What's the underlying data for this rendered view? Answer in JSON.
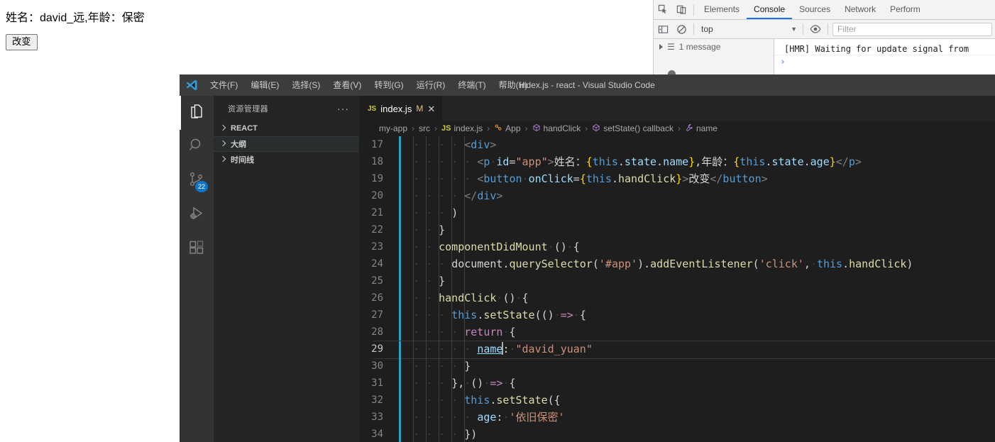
{
  "page": {
    "result_text": "姓名：david_远,年龄：保密",
    "button_label": "改变"
  },
  "devtools": {
    "icons": {
      "inspect": "inspect-element-icon",
      "device": "device-toolbar-icon",
      "sidebar_toggle": "console-sidebar-toggle-icon",
      "clear": "clear-console-icon",
      "eye": "live-expression-icon"
    },
    "tabs": [
      {
        "label": "Elements",
        "active": false
      },
      {
        "label": "Console",
        "active": true
      },
      {
        "label": "Sources",
        "active": false
      },
      {
        "label": "Network",
        "active": false
      },
      {
        "label": "Perform",
        "active": false
      }
    ],
    "context_selector": {
      "value": "top"
    },
    "filter": {
      "placeholder": "Filter",
      "value": ""
    },
    "sidebar": {
      "message_count_label": "1 message"
    },
    "log": [
      {
        "text": "[HMR] Waiting for update signal from"
      }
    ],
    "prompt_symbol": "›",
    "accent_color": "#1a73e8"
  },
  "vscode": {
    "window_title": "index.js - react - Visual Studio Code",
    "menu": [
      "文件(F)",
      "编辑(E)",
      "选择(S)",
      "查看(V)",
      "转到(G)",
      "运行(R)",
      "终端(T)",
      "帮助(H)"
    ],
    "activity_bar": [
      {
        "name": "explorer",
        "icon": "files-icon",
        "active": true,
        "badge": ""
      },
      {
        "name": "search",
        "icon": "search-icon",
        "active": false,
        "badge": ""
      },
      {
        "name": "source-control",
        "icon": "source-control-icon",
        "active": false,
        "badge": "22"
      },
      {
        "name": "run-and-debug",
        "icon": "run-debug-icon",
        "active": false,
        "badge": ""
      },
      {
        "name": "extensions",
        "icon": "extensions-icon",
        "active": false,
        "badge": ""
      }
    ],
    "sidebar": {
      "title": "资源管理器",
      "more_actions": "···",
      "sections": [
        {
          "label": "REACT",
          "expanded": false,
          "highlight": false
        },
        {
          "label": "大纲",
          "expanded": false,
          "highlight": true
        },
        {
          "label": "时间线",
          "expanded": false,
          "highlight": false
        }
      ]
    },
    "tabs": [
      {
        "badge": "JS",
        "label": "index.js",
        "modified": "M",
        "close": "✕",
        "active": true
      }
    ],
    "breadcrumb": [
      {
        "icon": "",
        "label": "my-app"
      },
      {
        "icon": "",
        "label": "src"
      },
      {
        "icon": "JS",
        "label": "index.js"
      },
      {
        "icon": "class",
        "label": "App"
      },
      {
        "icon": "method",
        "label": "handClick"
      },
      {
        "icon": "method",
        "label": "setState() callback"
      },
      {
        "icon": "property",
        "label": "name"
      }
    ],
    "code": {
      "first_line_number": 17,
      "active_line_number": 29,
      "lines": [
        {
          "n": 17,
          "indent": 4,
          "tokens": [
            {
              "t": "<",
              "c": "t-punc"
            },
            {
              "t": "div",
              "c": "t-tag"
            },
            {
              "t": ">",
              "c": "t-punc"
            }
          ]
        },
        {
          "n": 18,
          "indent": 5,
          "tokens": [
            {
              "t": "<",
              "c": "t-punc"
            },
            {
              "t": "p",
              "c": "t-tag"
            },
            {
              "t": " ",
              "c": "ws"
            },
            {
              "t": "id",
              "c": "t-attr"
            },
            {
              "t": "=",
              "c": "t-plain"
            },
            {
              "t": "\"app\"",
              "c": "t-str"
            },
            {
              "t": ">",
              "c": "t-punc"
            },
            {
              "t": "姓名：",
              "c": "t-cjk"
            },
            {
              "t": "{",
              "c": "t-brace"
            },
            {
              "t": "this",
              "c": "t-this"
            },
            {
              "t": ".",
              "c": "t-plain"
            },
            {
              "t": "state",
              "c": "t-prop"
            },
            {
              "t": ".",
              "c": "t-plain"
            },
            {
              "t": "name",
              "c": "t-prop"
            },
            {
              "t": "}",
              "c": "t-brace"
            },
            {
              "t": ",年龄：",
              "c": "t-cjk"
            },
            {
              "t": "{",
              "c": "t-brace"
            },
            {
              "t": "this",
              "c": "t-this"
            },
            {
              "t": ".",
              "c": "t-plain"
            },
            {
              "t": "state",
              "c": "t-prop"
            },
            {
              "t": ".",
              "c": "t-plain"
            },
            {
              "t": "age",
              "c": "t-prop"
            },
            {
              "t": "}",
              "c": "t-brace"
            },
            {
              "t": "</",
              "c": "t-punc"
            },
            {
              "t": "p",
              "c": "t-tag"
            },
            {
              "t": ">",
              "c": "t-punc"
            }
          ]
        },
        {
          "n": 19,
          "indent": 5,
          "tokens": [
            {
              "t": "<",
              "c": "t-punc"
            },
            {
              "t": "button",
              "c": "t-tag"
            },
            {
              "t": " ",
              "c": "ws"
            },
            {
              "t": "onClick",
              "c": "t-attr"
            },
            {
              "t": "=",
              "c": "t-plain"
            },
            {
              "t": "{",
              "c": "t-brace"
            },
            {
              "t": "this",
              "c": "t-this"
            },
            {
              "t": ".",
              "c": "t-plain"
            },
            {
              "t": "handClick",
              "c": "t-fn"
            },
            {
              "t": "}",
              "c": "t-brace"
            },
            {
              "t": ">",
              "c": "t-punc"
            },
            {
              "t": "改变",
              "c": "t-cjk"
            },
            {
              "t": "</",
              "c": "t-punc"
            },
            {
              "t": "button",
              "c": "t-tag"
            },
            {
              "t": ">",
              "c": "t-punc"
            }
          ]
        },
        {
          "n": 20,
          "indent": 4,
          "tokens": [
            {
              "t": "</",
              "c": "t-punc"
            },
            {
              "t": "div",
              "c": "t-tag"
            },
            {
              "t": ">",
              "c": "t-punc"
            }
          ]
        },
        {
          "n": 21,
          "indent": 3,
          "tokens": [
            {
              "t": ")",
              "c": "t-plain"
            }
          ]
        },
        {
          "n": 22,
          "indent": 2,
          "tokens": [
            {
              "t": "}",
              "c": "t-plain"
            }
          ]
        },
        {
          "n": 23,
          "indent": 2,
          "tokens": [
            {
              "t": "componentDidMount",
              "c": "t-fn"
            },
            {
              "t": " ",
              "c": "ws"
            },
            {
              "t": "()",
              "c": "t-plain"
            },
            {
              "t": " ",
              "c": "ws"
            },
            {
              "t": "{",
              "c": "t-plain"
            }
          ]
        },
        {
          "n": 24,
          "indent": 3,
          "tokens": [
            {
              "t": "document",
              "c": "t-plain"
            },
            {
              "t": ".",
              "c": "t-plain"
            },
            {
              "t": "querySelector",
              "c": "t-fn"
            },
            {
              "t": "(",
              "c": "t-plain"
            },
            {
              "t": "'#app'",
              "c": "t-str"
            },
            {
              "t": ")",
              "c": "t-plain"
            },
            {
              "t": ".",
              "c": "t-plain"
            },
            {
              "t": "addEventListener",
              "c": "t-fn"
            },
            {
              "t": "(",
              "c": "t-plain"
            },
            {
              "t": "'click'",
              "c": "t-str"
            },
            {
              "t": ",",
              "c": "t-plain"
            },
            {
              "t": " ",
              "c": "ws"
            },
            {
              "t": "this",
              "c": "t-this"
            },
            {
              "t": ".",
              "c": "t-plain"
            },
            {
              "t": "handClick",
              "c": "t-fn"
            },
            {
              "t": ")",
              "c": "t-plain"
            }
          ]
        },
        {
          "n": 25,
          "indent": 2,
          "tokens": [
            {
              "t": "}",
              "c": "t-plain"
            }
          ]
        },
        {
          "n": 26,
          "indent": 2,
          "tokens": [
            {
              "t": "handClick",
              "c": "t-fn"
            },
            {
              "t": " ",
              "c": "ws"
            },
            {
              "t": "()",
              "c": "t-plain"
            },
            {
              "t": " ",
              "c": "ws"
            },
            {
              "t": "{",
              "c": "t-plain"
            }
          ]
        },
        {
          "n": 27,
          "indent": 3,
          "tokens": [
            {
              "t": "this",
              "c": "t-this"
            },
            {
              "t": ".",
              "c": "t-plain"
            },
            {
              "t": "setState",
              "c": "t-fn"
            },
            {
              "t": "(()",
              "c": "t-plain"
            },
            {
              "t": " ",
              "c": "ws"
            },
            {
              "t": "=>",
              "c": "t-kw2"
            },
            {
              "t": " ",
              "c": "ws"
            },
            {
              "t": "{",
              "c": "t-plain"
            }
          ]
        },
        {
          "n": 28,
          "indent": 4,
          "tokens": [
            {
              "t": "return",
              "c": "t-kw2"
            },
            {
              "t": " ",
              "c": "ws"
            },
            {
              "t": "{",
              "c": "t-plain"
            }
          ]
        },
        {
          "n": 29,
          "indent": 5,
          "active": true,
          "tokens": [
            {
              "t": "name",
              "c": "t-underline"
            },
            {
              "t": "|",
              "c": "cursor"
            },
            {
              "t": ":",
              "c": "t-plain"
            },
            {
              "t": " ",
              "c": "ws"
            },
            {
              "t": "\"david_yuan\"",
              "c": "t-str"
            }
          ]
        },
        {
          "n": 30,
          "indent": 4,
          "tokens": [
            {
              "t": "}",
              "c": "t-plain"
            }
          ]
        },
        {
          "n": 31,
          "indent": 3,
          "tokens": [
            {
              "t": "},",
              "c": "t-plain"
            },
            {
              "t": " ",
              "c": "ws"
            },
            {
              "t": "()",
              "c": "t-plain"
            },
            {
              "t": " ",
              "c": "ws"
            },
            {
              "t": "=>",
              "c": "t-kw2"
            },
            {
              "t": " ",
              "c": "ws"
            },
            {
              "t": "{",
              "c": "t-plain"
            }
          ]
        },
        {
          "n": 32,
          "indent": 4,
          "tokens": [
            {
              "t": "this",
              "c": "t-this"
            },
            {
              "t": ".",
              "c": "t-plain"
            },
            {
              "t": "setState",
              "c": "t-fn"
            },
            {
              "t": "({",
              "c": "t-plain"
            }
          ]
        },
        {
          "n": 33,
          "indent": 5,
          "tokens": [
            {
              "t": "age",
              "c": "t-prop"
            },
            {
              "t": ":",
              "c": "t-plain"
            },
            {
              "t": " ",
              "c": "ws"
            },
            {
              "t": "'依旧保密'",
              "c": "t-str"
            }
          ]
        },
        {
          "n": 34,
          "indent": 4,
          "tokens": [
            {
              "t": "})",
              "c": "t-plain"
            }
          ]
        }
      ]
    }
  }
}
